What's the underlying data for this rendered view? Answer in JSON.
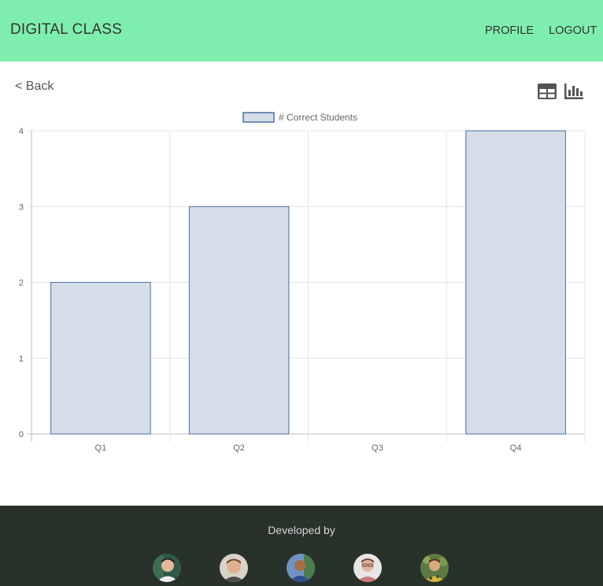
{
  "header": {
    "brand": "DIGITAL CLASS",
    "nav": {
      "profile_label": "PROFILE",
      "logout_label": "LOGOUT"
    },
    "background_color": "#7eeeae"
  },
  "back": {
    "label": "< Back"
  },
  "view_toggle": {
    "icons": [
      "table-view-icon",
      "bar-chart-view-icon"
    ]
  },
  "chart_data": {
    "type": "bar",
    "categories": [
      "Q1",
      "Q2",
      "Q3",
      "Q4"
    ],
    "series": [
      {
        "name": "# Correct Students",
        "values": [
          2,
          3,
          0,
          4
        ]
      }
    ],
    "yticks": [
      0,
      1,
      2,
      3,
      4
    ],
    "ylim": [
      0,
      4
    ],
    "grid": true,
    "legend": "top-center",
    "bar_fill": "#d4dee8",
    "bar_stroke": "#4a6fa5"
  },
  "footer": {
    "text": "Developed by",
    "background_color": "#29312b",
    "avatars": [
      "avatar-icon",
      "avatar-icon",
      "avatar-icon",
      "avatar-icon",
      "avatar-icon"
    ]
  }
}
